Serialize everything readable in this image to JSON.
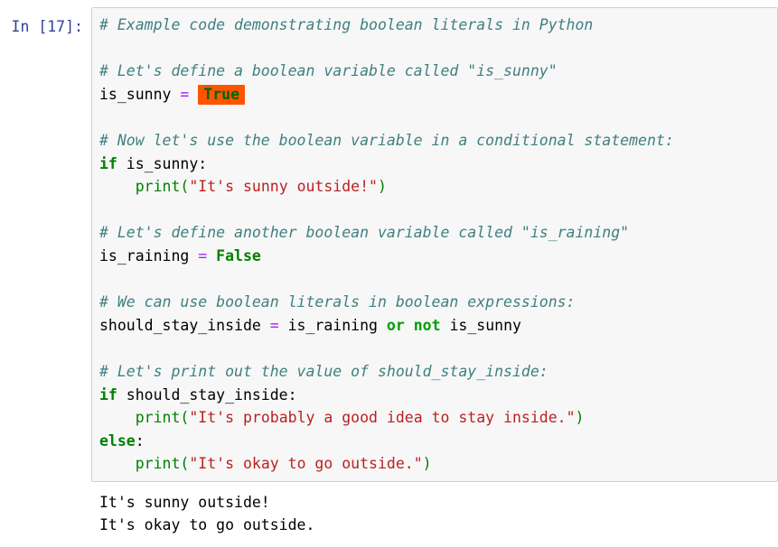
{
  "cell": {
    "prompt_label": "In [17]:",
    "execution_count": 17,
    "lines": {
      "l1_comment": "# Example code demonstrating boolean literals in Python",
      "l3_comment": "# Let's define a boolean variable called \"is_sunny\"",
      "l4_name": "is_sunny ",
      "l4_operator": "=",
      "l4_value_highlighted": "True",
      "l6_comment": "# Now let's use the boolean variable in a conditional statement:",
      "l7_keyword": "if",
      "l7_rest": " is_sunny:",
      "l8_indent": "    ",
      "l8_builtin": "print",
      "l8_open_paren": "(",
      "l8_string": "\"It's sunny outside!\"",
      "l8_close_paren": ")",
      "l10_comment": "# Let's define another boolean variable called \"is_raining\"",
      "l11_name": "is_raining ",
      "l11_operator": "=",
      "l11_value": " False",
      "l13_comment": "# We can use boolean literals in boolean expressions:",
      "l14_name": "should_stay_inside ",
      "l14_operator": "=",
      "l14_mid": " is_raining ",
      "l14_or": "or",
      "l14_space": " ",
      "l14_not": "not",
      "l14_tail": " is_sunny",
      "l16_comment": "# Let's print out the value of should_stay_inside:",
      "l17_keyword": "if",
      "l17_rest": " should_stay_inside:",
      "l18_indent": "    ",
      "l18_builtin": "print",
      "l18_open_paren": "(",
      "l18_string": "\"It's probably a good idea to stay inside.\"",
      "l18_close_paren": ")",
      "l19_keyword": "else",
      "l19_colon": ":",
      "l20_indent": "    ",
      "l20_builtin": "print",
      "l20_open_paren": "(",
      "l20_string": "\"It's okay to go outside.\"",
      "l20_close_paren": ")"
    }
  },
  "output": {
    "line1": "It's sunny outside!",
    "line2": "It's okay to go outside."
  },
  "colors": {
    "prompt": "#303f9f",
    "comment": "#408080",
    "keyword": "#008000",
    "keyword_constant": "#008000",
    "operator_word": "#00a000",
    "builtin": "#008000",
    "string": "#ba2121",
    "operator": "#aa22ff",
    "highlight_background": "#ff5500",
    "highlight_text": "#006400",
    "cell_background": "#f7f7f7",
    "cell_border": "#cfcfcf",
    "text": "#000000",
    "page_background": "#ffffff"
  }
}
